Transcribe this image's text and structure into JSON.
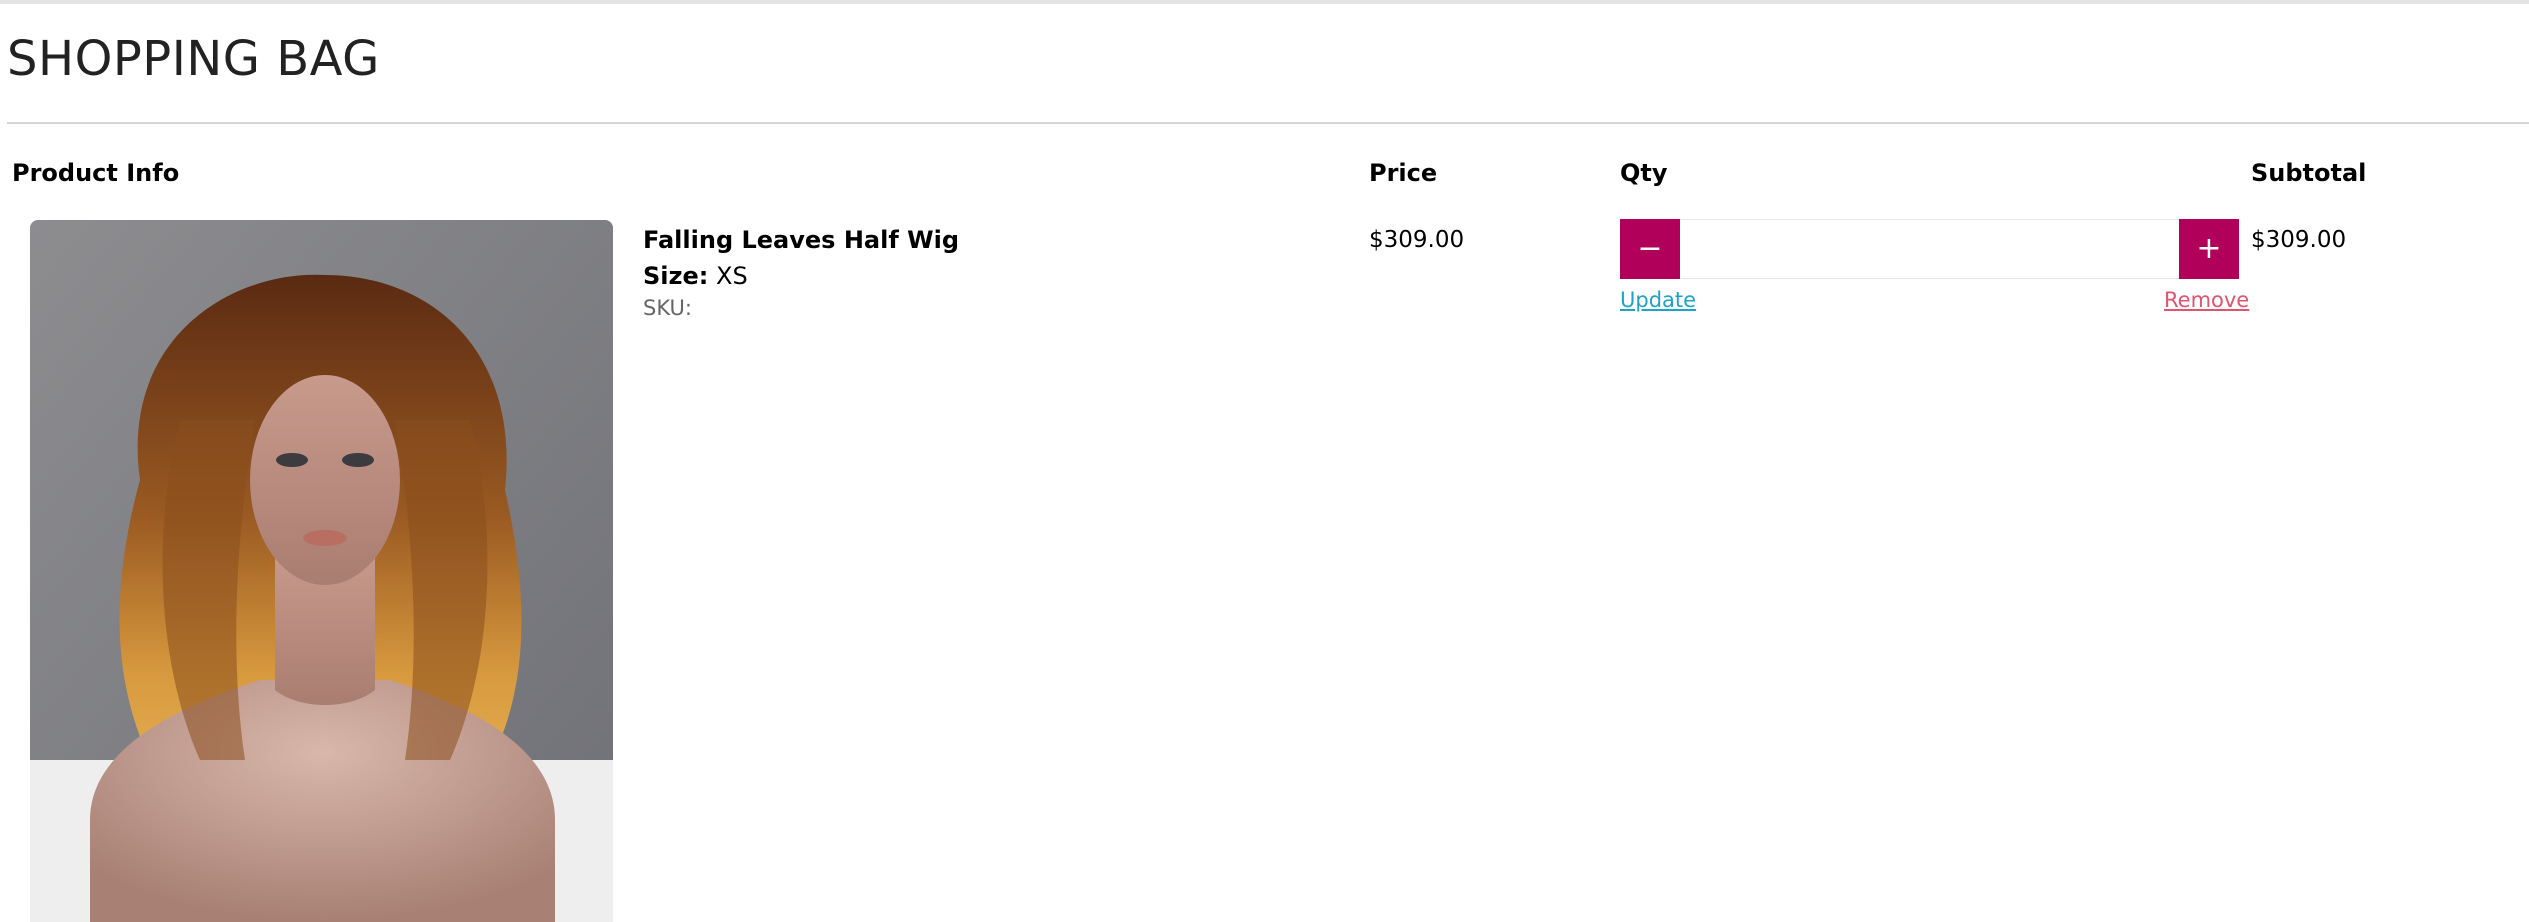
{
  "page": {
    "title": "SHOPPING BAG"
  },
  "table": {
    "headers": {
      "product_info": "Product Info",
      "price": "Price",
      "qty": "Qty",
      "subtotal": "Subtotal"
    }
  },
  "items": [
    {
      "name": "Falling Leaves Half Wig",
      "size_label": "Size:",
      "size_value": "XS",
      "sku_label": "SKU:",
      "price": "$309.00",
      "qty": "",
      "subtotal": "$309.00",
      "image_icon": "curly-wig-on-mannequin-image"
    }
  ],
  "qty_controls": {
    "minus_glyph": "−",
    "plus_glyph": "+",
    "update_label": "Update",
    "remove_label": "Remove"
  },
  "colors": {
    "accent": "#b0005a",
    "update_link": "#1fa3c7",
    "remove_link": "#e0546e"
  }
}
